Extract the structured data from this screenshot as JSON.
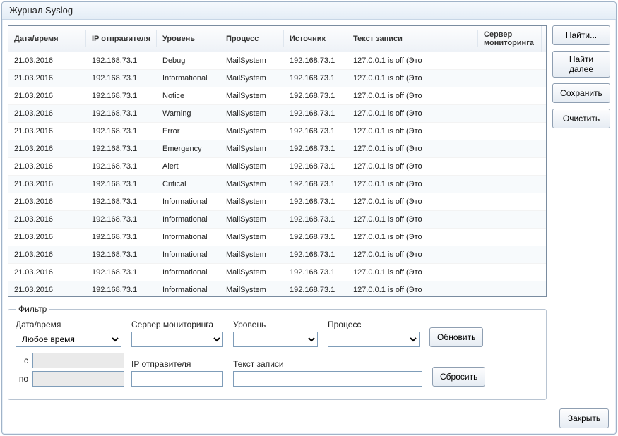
{
  "window": {
    "title": "Журнал Syslog"
  },
  "columns": {
    "datetime": "Дата/время",
    "sender_ip": "IP отправителя",
    "level": "Уровень",
    "process": "Процесс",
    "source": "Источник",
    "text": "Текст записи",
    "monitor_server": "Сервер мониторинга"
  },
  "rows": [
    {
      "date": "21.03.2016",
      "ip": "192.168.73.1",
      "level": "Debug",
      "process": "MailSystem",
      "source": "192.168.73.1",
      "text": "127.0.0.1 is off (Это"
    },
    {
      "date": "21.03.2016",
      "ip": "192.168.73.1",
      "level": "Informational",
      "process": "MailSystem",
      "source": "192.168.73.1",
      "text": "127.0.0.1 is off (Это"
    },
    {
      "date": "21.03.2016",
      "ip": "192.168.73.1",
      "level": "Notice",
      "process": "MailSystem",
      "source": "192.168.73.1",
      "text": "127.0.0.1 is off (Это"
    },
    {
      "date": "21.03.2016",
      "ip": "192.168.73.1",
      "level": "Warning",
      "process": "MailSystem",
      "source": "192.168.73.1",
      "text": "127.0.0.1 is off (Это"
    },
    {
      "date": "21.03.2016",
      "ip": "192.168.73.1",
      "level": "Error",
      "process": "MailSystem",
      "source": "192.168.73.1",
      "text": "127.0.0.1 is off (Это"
    },
    {
      "date": "21.03.2016",
      "ip": "192.168.73.1",
      "level": "Emergency",
      "process": "MailSystem",
      "source": "192.168.73.1",
      "text": "127.0.0.1 is off (Это"
    },
    {
      "date": "21.03.2016",
      "ip": "192.168.73.1",
      "level": "Alert",
      "process": "MailSystem",
      "source": "192.168.73.1",
      "text": "127.0.0.1 is off (Это"
    },
    {
      "date": "21.03.2016",
      "ip": "192.168.73.1",
      "level": "Critical",
      "process": "MailSystem",
      "source": "192.168.73.1",
      "text": "127.0.0.1 is off (Это"
    },
    {
      "date": "21.03.2016",
      "ip": "192.168.73.1",
      "level": "Informational",
      "process": "MailSystem",
      "source": "192.168.73.1",
      "text": "127.0.0.1 is off (Это"
    },
    {
      "date": "21.03.2016",
      "ip": "192.168.73.1",
      "level": "Informational",
      "process": "MailSystem",
      "source": "192.168.73.1",
      "text": "127.0.0.1 is off (Это"
    },
    {
      "date": "21.03.2016",
      "ip": "192.168.73.1",
      "level": "Informational",
      "process": "MailSystem",
      "source": "192.168.73.1",
      "text": "127.0.0.1 is off (Это"
    },
    {
      "date": "21.03.2016",
      "ip": "192.168.73.1",
      "level": "Informational",
      "process": "MailSystem",
      "source": "192.168.73.1",
      "text": "127.0.0.1 is off (Это"
    },
    {
      "date": "21.03.2016",
      "ip": "192.168.73.1",
      "level": "Informational",
      "process": "MailSystem",
      "source": "192.168.73.1",
      "text": "127.0.0.1 is off (Это"
    },
    {
      "date": "21.03.2016",
      "ip": "192.168.73.1",
      "level": "Informational",
      "process": "MailSystem",
      "source": "192.168.73.1",
      "text": "127.0.0.1 is off (Это"
    }
  ],
  "side_buttons": {
    "find": "Найти...",
    "find_next": "Найти далее",
    "save": "Сохранить",
    "clear": "Очистить"
  },
  "filter": {
    "legend": "Фильтр",
    "labels": {
      "datetime": "Дата/время",
      "monitor_server": "Сервер мониторинга",
      "level": "Уровень",
      "process": "Процесс",
      "sender_ip": "IP отправителя",
      "text": "Текст записи",
      "from": "с",
      "to": "по"
    },
    "datetime_value": "Любое время",
    "buttons": {
      "refresh": "Обновить",
      "reset": "Сбросить"
    }
  },
  "footer": {
    "close": "Закрыть"
  }
}
